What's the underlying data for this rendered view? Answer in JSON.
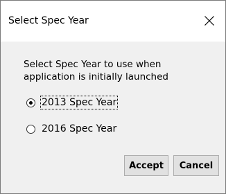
{
  "window": {
    "title": "Select Spec Year",
    "close_glyph": "close-icon"
  },
  "prompt": {
    "line1": "Select Spec Year to use when",
    "line2": "application is initially launched"
  },
  "options": [
    {
      "label": "2013 Spec Year",
      "selected": true
    },
    {
      "label": "2016 Spec Year",
      "selected": false
    }
  ],
  "buttons": {
    "accept_label": "Accept",
    "cancel_label": "Cancel"
  }
}
